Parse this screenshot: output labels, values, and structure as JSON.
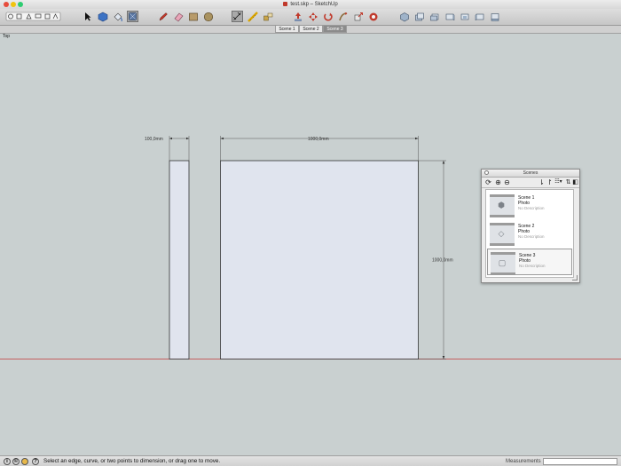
{
  "window": {
    "title": "test.skp – SketchUp"
  },
  "toolbar": {
    "tools": [
      {
        "name": "select-tool",
        "icon": "arrow-icon"
      },
      {
        "name": "make-component-tool",
        "icon": "component-icon"
      },
      {
        "name": "paint-bucket-tool",
        "icon": "paint-bucket-icon"
      },
      {
        "name": "eraser-tool",
        "icon": "eraser-icon"
      },
      {
        "name": "pencil-tool",
        "icon": "pencil-icon"
      },
      {
        "name": "rectangle-tool",
        "icon": "rectangle-icon"
      },
      {
        "name": "circle-tool",
        "icon": "circle-icon"
      },
      {
        "name": "dimension-tool",
        "icon": "dimension-icon"
      },
      {
        "name": "tape-measure-tool",
        "icon": "tape-measure-icon"
      },
      {
        "name": "orbit-tool",
        "icon": "orbit-icon"
      },
      {
        "name": "pan-tool",
        "icon": "pan-icon"
      },
      {
        "name": "zoom-tool",
        "icon": "zoom-icon"
      },
      {
        "name": "iso-view",
        "icon": "iso-view-icon"
      },
      {
        "name": "top-view",
        "icon": "top-view-icon"
      },
      {
        "name": "front-view",
        "icon": "front-view-icon"
      }
    ]
  },
  "scene_tabs": [
    {
      "label": "Scene 1",
      "active": false
    },
    {
      "label": "Scene 2",
      "active": false
    },
    {
      "label": "Scene 3",
      "active": true
    }
  ],
  "viewport": {
    "view_name": "Top",
    "dimensions": {
      "small_width": "100,0mm",
      "large_width": "1000,0mm",
      "height": "1000,0mm"
    }
  },
  "scenes_panel": {
    "title": "Scenes",
    "tools": [
      "refresh-icon",
      "add-icon",
      "remove-icon",
      "move-down-icon",
      "move-up-icon",
      "view-options-icon",
      "details-icon",
      "toggle-icon"
    ],
    "items": [
      {
        "name": "Scene 1",
        "type": "Photo",
        "description": "No Description",
        "selected": false,
        "thumb_icon": "cube-icon"
      },
      {
        "name": "Scene 2",
        "type": "Photo",
        "description": "No Description",
        "selected": false,
        "thumb_icon": "plane-icon"
      },
      {
        "name": "Scene 3",
        "type": "Photo",
        "description": "No Description",
        "selected": true,
        "thumb_icon": "frame-icon"
      }
    ]
  },
  "statusbar": {
    "message": "Select an edge, curve, or two points to dimension, or drag one to move.",
    "measurements_label": "Measurements",
    "measurements_value": ""
  }
}
